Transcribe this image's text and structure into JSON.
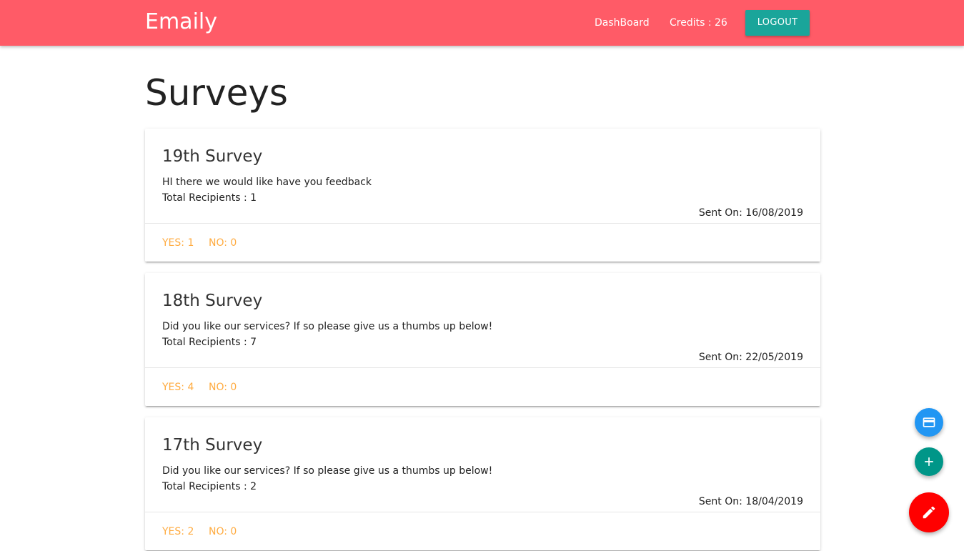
{
  "navbar": {
    "brand": "Emaily",
    "dashboard_label": "DashBoard",
    "credits_label": "Credits : 26",
    "logout_label": "LOGOUT"
  },
  "page": {
    "title": "Surveys"
  },
  "surveys": [
    {
      "title": "19th Survey",
      "body": "HI there we would like have you feedback",
      "recipients": "Total Recipients : 1",
      "sent_on": "Sent On: 16/08/2019",
      "yes": "YES: 1",
      "no": "NO: 0"
    },
    {
      "title": "18th Survey",
      "body": "Did you like our services? If so please give us a thumbs up below!",
      "recipients": "Total Recipients : 7",
      "sent_on": "Sent On: 22/05/2019",
      "yes": "YES: 4",
      "no": "NO: 0"
    },
    {
      "title": "17th Survey",
      "body": "Did you like our services? If so please give us a thumbs up below!",
      "recipients": "Total Recipients : 2",
      "sent_on": "Sent On: 18/04/2019",
      "yes": "YES: 2",
      "no": "NO: 0"
    }
  ],
  "fabs": [
    {
      "icon": "credit-card-icon",
      "color": "#2196f3"
    },
    {
      "icon": "add-icon",
      "color": "#009688"
    },
    {
      "icon": "edit-pencil-icon",
      "color": "#ff0000"
    }
  ],
  "colors": {
    "navbar": "#ff5b67",
    "logout_button": "#1aa59a",
    "vote_counts": "#ffab40"
  }
}
